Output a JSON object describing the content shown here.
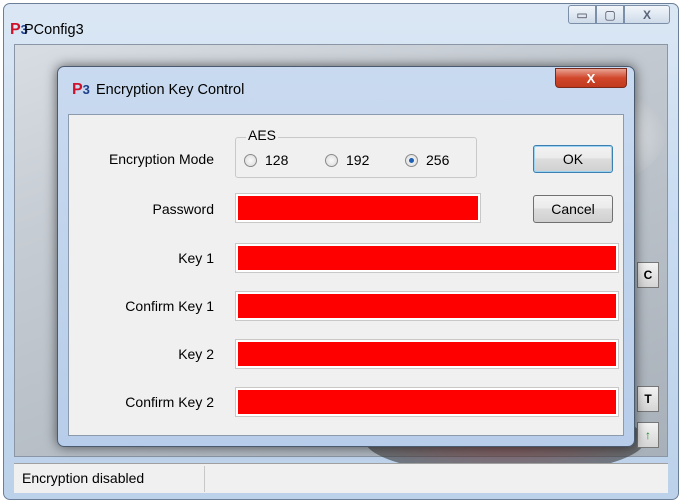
{
  "outer_window": {
    "title": "PConfig3",
    "logo_letter": "P",
    "logo_digit": "3",
    "minimize_glyph": "▭",
    "maximize_glyph": "▢",
    "close_glyph": "X",
    "side_buttons": [
      "C",
      "T",
      "↑"
    ],
    "status_text": "Encryption disabled"
  },
  "dialog": {
    "title": "Encryption Key Control",
    "logo_letter": "P",
    "logo_digit": "3",
    "close_glyph": "X",
    "encryption_mode_label": "Encryption Mode",
    "aes_group_title": "AES",
    "options": [
      "128",
      "192",
      "256"
    ],
    "selected_option": "256",
    "password_label": "Password",
    "key1_label": "Key 1",
    "confirm_key1_label": "Confirm Key 1",
    "key2_label": "Key 2",
    "confirm_key2_label": "Confirm Key 2",
    "ok_label": "OK",
    "cancel_label": "Cancel",
    "field_fill_color": "#ff0000"
  }
}
